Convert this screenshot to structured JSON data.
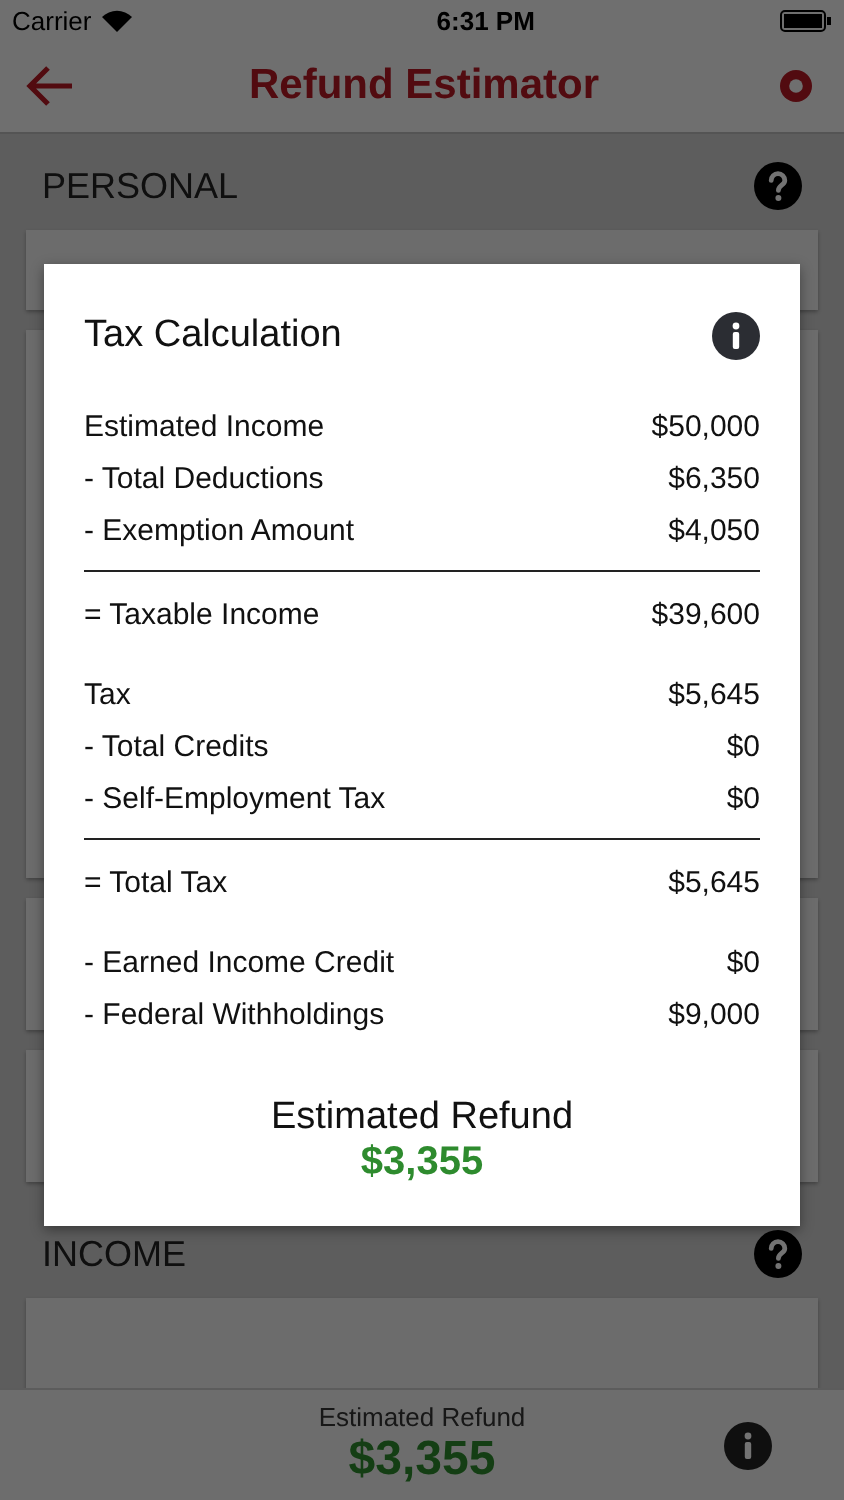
{
  "status_bar": {
    "carrier": "Carrier",
    "time": "6:31 PM"
  },
  "nav": {
    "title": "Refund Estimator"
  },
  "sections": [
    {
      "title": "PERSONAL"
    },
    {
      "title": "INCOME"
    }
  ],
  "footer": {
    "label": "Estimated Refund",
    "amount": "$3,355"
  },
  "dialog": {
    "title": "Tax Calculation",
    "groups": [
      {
        "rows": [
          {
            "label": "Estimated Income",
            "value": "$50,000"
          },
          {
            "label": "- Total Deductions",
            "value": "$6,350"
          },
          {
            "label": "- Exemption Amount",
            "value": "$4,050"
          }
        ],
        "total": {
          "label": "= Taxable Income",
          "value": "$39,600"
        }
      },
      {
        "rows": [
          {
            "label": "Tax",
            "value": "$5,645"
          },
          {
            "label": "- Total Credits",
            "value": "$0"
          },
          {
            "label": "- Self-Employment Tax",
            "value": "$0"
          }
        ],
        "total": {
          "label": "= Total Tax",
          "value": "$5,645"
        }
      },
      {
        "rows": [
          {
            "label": "- Earned Income Credit",
            "value": "$0"
          },
          {
            "label": "- Federal Withholdings",
            "value": "$9,000"
          }
        ]
      }
    ],
    "result_label": "Estimated Refund",
    "result_amount": "$3,355"
  }
}
